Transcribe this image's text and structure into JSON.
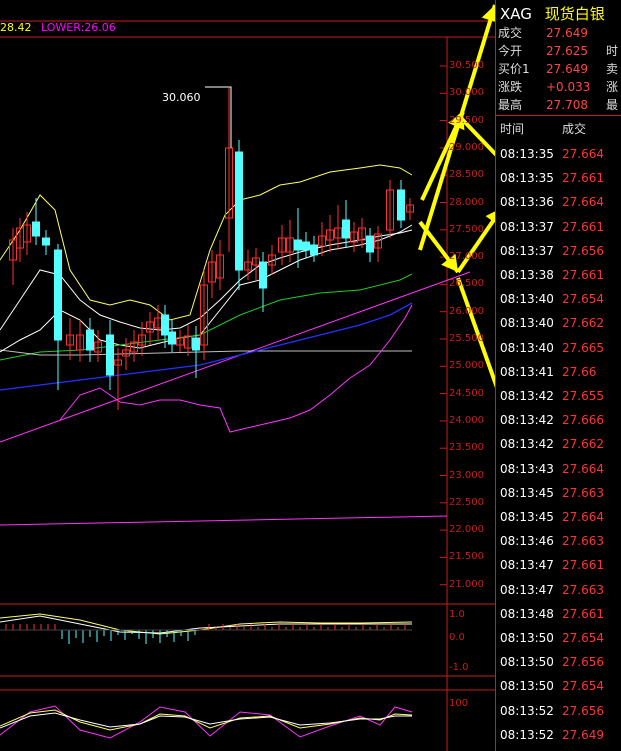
{
  "legend": {
    "upper": "28.42",
    "lower_label": "LOWER:26.06"
  },
  "price_axis": [
    "30.500",
    "30.000",
    "29.500",
    "29.000",
    "28.500",
    "28.000",
    "27.500",
    "27.000",
    "26.500",
    "26.000",
    "25.500",
    "25.000",
    "24.500",
    "24.000",
    "23.500",
    "23.000",
    "22.500",
    "22.000",
    "21.500",
    "21.000"
  ],
  "peak_label": "30.060",
  "macd_axis": [
    "1.0",
    "0.0",
    "-1.0"
  ],
  "kdj_axis": [
    "100"
  ],
  "quote": {
    "symbol": "XAG",
    "name": "现货白银",
    "rows": [
      {
        "label": "成交",
        "value": "27.649",
        "extra": ""
      },
      {
        "label": "今开",
        "value": "27.625",
        "extra": "时"
      },
      {
        "label": "买价1",
        "value": "27.649",
        "extra": "卖"
      },
      {
        "label": "涨跌",
        "value": "+0.033",
        "extra": "涨"
      },
      {
        "label": "最高",
        "value": "27.708",
        "extra": "最"
      }
    ]
  },
  "ticks_header": {
    "time": "时间",
    "price": "成交"
  },
  "ticks": [
    {
      "time": "08:13:35",
      "price": "27.664"
    },
    {
      "time": "08:13:35",
      "price": "27.661"
    },
    {
      "time": "08:13:36",
      "price": "27.664"
    },
    {
      "time": "08:13:37",
      "price": "27.661"
    },
    {
      "time": "08:13:37",
      "price": "27.656"
    },
    {
      "time": "08:13:38",
      "price": "27.661"
    },
    {
      "time": "08:13:40",
      "price": "27.654"
    },
    {
      "time": "08:13:40",
      "price": "27.662"
    },
    {
      "time": "08:13:40",
      "price": "27.665"
    },
    {
      "time": "08:13:41",
      "price": "27.66"
    },
    {
      "time": "08:13:42",
      "price": "27.655"
    },
    {
      "time": "08:13:42",
      "price": "27.666"
    },
    {
      "time": "08:13:42",
      "price": "27.662"
    },
    {
      "time": "08:13:43",
      "price": "27.664"
    },
    {
      "time": "08:13:45",
      "price": "27.663"
    },
    {
      "time": "08:13:45",
      "price": "27.664"
    },
    {
      "time": "08:13:46",
      "price": "27.663"
    },
    {
      "time": "08:13:47",
      "price": "27.661"
    },
    {
      "time": "08:13:47",
      "price": "27.663"
    },
    {
      "time": "08:13:48",
      "price": "27.661"
    },
    {
      "time": "08:13:50",
      "price": "27.654"
    },
    {
      "time": "08:13:50",
      "price": "27.656"
    },
    {
      "time": "08:13:50",
      "price": "27.654"
    },
    {
      "time": "08:13:52",
      "price": "27.656"
    },
    {
      "time": "08:13:52",
      "price": "27.649"
    }
  ],
  "colors": {
    "grid": "#c81e1e",
    "up": "#ff3030",
    "down": "#54ffff",
    "boll": "#ffff66",
    "ma_white": "#ffffff",
    "ma_green": "#22cc22",
    "ma_blue": "#2233ff",
    "magenta": "#ff33ff",
    "arrow": "#ffff00"
  }
}
